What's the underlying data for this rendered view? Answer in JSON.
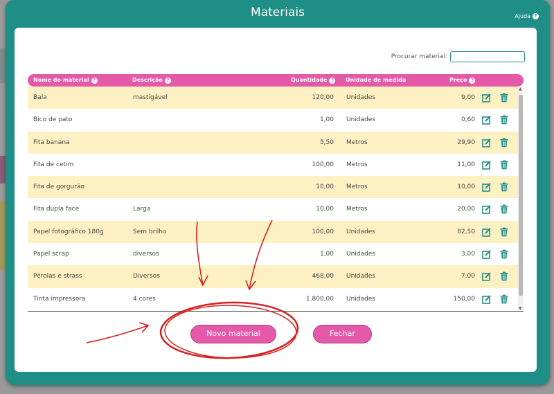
{
  "modal": {
    "title": "Materiais",
    "help_label": "Ajuda",
    "search_label": "Procurar material:",
    "search_value": ""
  },
  "table": {
    "headers": {
      "name": "Nome do material",
      "description": "Descrição",
      "quantity": "Quantidade",
      "unit": "Unidade de medida",
      "price": "Preço"
    },
    "rows": [
      {
        "name": "Bala",
        "description": "mastigável",
        "quantity": "120,00",
        "unit": "Unidades",
        "price": "9,00"
      },
      {
        "name": "Bico de pato",
        "description": "",
        "quantity": "1,00",
        "unit": "Unidades",
        "price": "0,60"
      },
      {
        "name": "Fita banana",
        "description": "",
        "quantity": "5,50",
        "unit": "Metros",
        "price": "29,90"
      },
      {
        "name": "Fita de cetim",
        "description": "",
        "quantity": "100,00",
        "unit": "Metros",
        "price": "11,00"
      },
      {
        "name": "Fita de gorgurão",
        "description": "",
        "quantity": "10,00",
        "unit": "Metros",
        "price": "10,00"
      },
      {
        "name": "Fita dupla face",
        "description": "Larga",
        "quantity": "10,00",
        "unit": "Metros",
        "price": "20,00"
      },
      {
        "name": "Papel fotográfico 180g",
        "description": "Sem brilho",
        "quantity": "100,00",
        "unit": "Unidades",
        "price": "82,50"
      },
      {
        "name": "Papel scrap",
        "description": "diversos",
        "quantity": "1,00",
        "unit": "Unidades",
        "price": "3,00"
      },
      {
        "name": "Pérolas e strass",
        "description": "Diversos",
        "quantity": "468,00",
        "unit": "Unidades",
        "price": "7,00"
      },
      {
        "name": "Tinta impressora",
        "description": "4 cores",
        "quantity": "1.800,00",
        "unit": "Unidades",
        "price": "150,00"
      }
    ],
    "row_actions": {
      "edit_icon": "edit-icon",
      "delete_icon": "trash-icon"
    }
  },
  "buttons": {
    "new_label": "Novo material",
    "close_label": "Fechar"
  },
  "colors": {
    "teal": "#1f8e86",
    "pink": "#e55aa8",
    "row_highlight": "#fdf1c4",
    "annotation_red": "#d42020"
  }
}
